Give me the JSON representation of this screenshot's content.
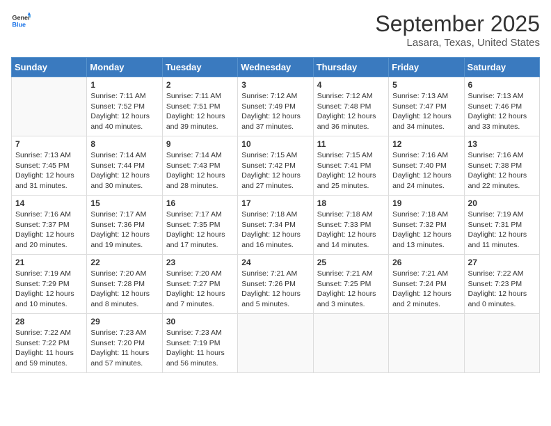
{
  "header": {
    "logo_general": "General",
    "logo_blue": "Blue",
    "month": "September 2025",
    "location": "Lasara, Texas, United States"
  },
  "weekdays": [
    "Sunday",
    "Monday",
    "Tuesday",
    "Wednesday",
    "Thursday",
    "Friday",
    "Saturday"
  ],
  "weeks": [
    [
      {
        "day": "",
        "info": ""
      },
      {
        "day": "1",
        "info": "Sunrise: 7:11 AM\nSunset: 7:52 PM\nDaylight: 12 hours\nand 40 minutes."
      },
      {
        "day": "2",
        "info": "Sunrise: 7:11 AM\nSunset: 7:51 PM\nDaylight: 12 hours\nand 39 minutes."
      },
      {
        "day": "3",
        "info": "Sunrise: 7:12 AM\nSunset: 7:49 PM\nDaylight: 12 hours\nand 37 minutes."
      },
      {
        "day": "4",
        "info": "Sunrise: 7:12 AM\nSunset: 7:48 PM\nDaylight: 12 hours\nand 36 minutes."
      },
      {
        "day": "5",
        "info": "Sunrise: 7:13 AM\nSunset: 7:47 PM\nDaylight: 12 hours\nand 34 minutes."
      },
      {
        "day": "6",
        "info": "Sunrise: 7:13 AM\nSunset: 7:46 PM\nDaylight: 12 hours\nand 33 minutes."
      }
    ],
    [
      {
        "day": "7",
        "info": "Sunrise: 7:13 AM\nSunset: 7:45 PM\nDaylight: 12 hours\nand 31 minutes."
      },
      {
        "day": "8",
        "info": "Sunrise: 7:14 AM\nSunset: 7:44 PM\nDaylight: 12 hours\nand 30 minutes."
      },
      {
        "day": "9",
        "info": "Sunrise: 7:14 AM\nSunset: 7:43 PM\nDaylight: 12 hours\nand 28 minutes."
      },
      {
        "day": "10",
        "info": "Sunrise: 7:15 AM\nSunset: 7:42 PM\nDaylight: 12 hours\nand 27 minutes."
      },
      {
        "day": "11",
        "info": "Sunrise: 7:15 AM\nSunset: 7:41 PM\nDaylight: 12 hours\nand 25 minutes."
      },
      {
        "day": "12",
        "info": "Sunrise: 7:16 AM\nSunset: 7:40 PM\nDaylight: 12 hours\nand 24 minutes."
      },
      {
        "day": "13",
        "info": "Sunrise: 7:16 AM\nSunset: 7:38 PM\nDaylight: 12 hours\nand 22 minutes."
      }
    ],
    [
      {
        "day": "14",
        "info": "Sunrise: 7:16 AM\nSunset: 7:37 PM\nDaylight: 12 hours\nand 20 minutes."
      },
      {
        "day": "15",
        "info": "Sunrise: 7:17 AM\nSunset: 7:36 PM\nDaylight: 12 hours\nand 19 minutes."
      },
      {
        "day": "16",
        "info": "Sunrise: 7:17 AM\nSunset: 7:35 PM\nDaylight: 12 hours\nand 17 minutes."
      },
      {
        "day": "17",
        "info": "Sunrise: 7:18 AM\nSunset: 7:34 PM\nDaylight: 12 hours\nand 16 minutes."
      },
      {
        "day": "18",
        "info": "Sunrise: 7:18 AM\nSunset: 7:33 PM\nDaylight: 12 hours\nand 14 minutes."
      },
      {
        "day": "19",
        "info": "Sunrise: 7:18 AM\nSunset: 7:32 PM\nDaylight: 12 hours\nand 13 minutes."
      },
      {
        "day": "20",
        "info": "Sunrise: 7:19 AM\nSunset: 7:31 PM\nDaylight: 12 hours\nand 11 minutes."
      }
    ],
    [
      {
        "day": "21",
        "info": "Sunrise: 7:19 AM\nSunset: 7:29 PM\nDaylight: 12 hours\nand 10 minutes."
      },
      {
        "day": "22",
        "info": "Sunrise: 7:20 AM\nSunset: 7:28 PM\nDaylight: 12 hours\nand 8 minutes."
      },
      {
        "day": "23",
        "info": "Sunrise: 7:20 AM\nSunset: 7:27 PM\nDaylight: 12 hours\nand 7 minutes."
      },
      {
        "day": "24",
        "info": "Sunrise: 7:21 AM\nSunset: 7:26 PM\nDaylight: 12 hours\nand 5 minutes."
      },
      {
        "day": "25",
        "info": "Sunrise: 7:21 AM\nSunset: 7:25 PM\nDaylight: 12 hours\nand 3 minutes."
      },
      {
        "day": "26",
        "info": "Sunrise: 7:21 AM\nSunset: 7:24 PM\nDaylight: 12 hours\nand 2 minutes."
      },
      {
        "day": "27",
        "info": "Sunrise: 7:22 AM\nSunset: 7:23 PM\nDaylight: 12 hours\nand 0 minutes."
      }
    ],
    [
      {
        "day": "28",
        "info": "Sunrise: 7:22 AM\nSunset: 7:22 PM\nDaylight: 11 hours\nand 59 minutes."
      },
      {
        "day": "29",
        "info": "Sunrise: 7:23 AM\nSunset: 7:20 PM\nDaylight: 11 hours\nand 57 minutes."
      },
      {
        "day": "30",
        "info": "Sunrise: 7:23 AM\nSunset: 7:19 PM\nDaylight: 11 hours\nand 56 minutes."
      },
      {
        "day": "",
        "info": ""
      },
      {
        "day": "",
        "info": ""
      },
      {
        "day": "",
        "info": ""
      },
      {
        "day": "",
        "info": ""
      }
    ]
  ]
}
